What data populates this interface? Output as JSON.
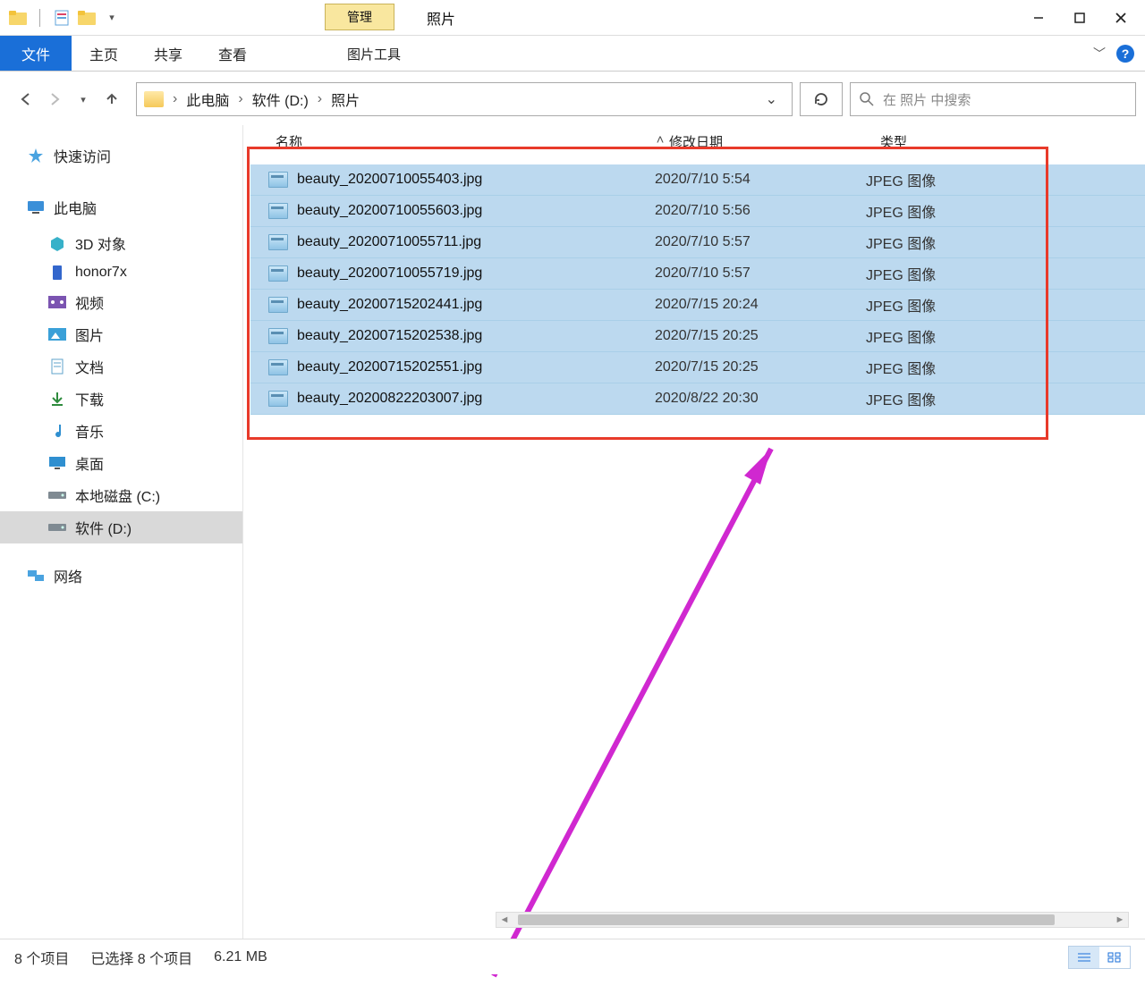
{
  "window": {
    "title": "照片"
  },
  "qat": {
    "manage_label": "管理"
  },
  "ribbon": {
    "file_label": "文件",
    "tabs": [
      "主页",
      "共享",
      "查看"
    ],
    "image_tools_label": "图片工具"
  },
  "nav": {
    "breadcrumb": [
      "此电脑",
      "软件 (D:)",
      "照片"
    ]
  },
  "search": {
    "placeholder": "在 照片 中搜索"
  },
  "sidebar": {
    "quick": "快速访问",
    "pc": "此电脑",
    "items": [
      {
        "label": "3D 对象",
        "icon": "cube"
      },
      {
        "label": "honor7x",
        "icon": "phone"
      },
      {
        "label": "视频",
        "icon": "video"
      },
      {
        "label": "图片",
        "icon": "picture"
      },
      {
        "label": "文档",
        "icon": "doc"
      },
      {
        "label": "下载",
        "icon": "download"
      },
      {
        "label": "音乐",
        "icon": "music"
      },
      {
        "label": "桌面",
        "icon": "desktop"
      },
      {
        "label": "本地磁盘 (C:)",
        "icon": "disk"
      },
      {
        "label": "软件 (D:)",
        "icon": "disk",
        "selected": true
      }
    ],
    "network": "网络"
  },
  "columns": {
    "name": "名称",
    "date": "修改日期",
    "type": "类型"
  },
  "files": [
    {
      "name": "beauty_20200710055403.jpg",
      "date": "2020/7/10 5:54",
      "type": "JPEG 图像"
    },
    {
      "name": "beauty_20200710055603.jpg",
      "date": "2020/7/10 5:56",
      "type": "JPEG 图像"
    },
    {
      "name": "beauty_20200710055711.jpg",
      "date": "2020/7/10 5:57",
      "type": "JPEG 图像"
    },
    {
      "name": "beauty_20200710055719.jpg",
      "date": "2020/7/10 5:57",
      "type": "JPEG 图像"
    },
    {
      "name": "beauty_20200715202441.jpg",
      "date": "2020/7/15 20:24",
      "type": "JPEG 图像"
    },
    {
      "name": "beauty_20200715202538.jpg",
      "date": "2020/7/15 20:25",
      "type": "JPEG 图像"
    },
    {
      "name": "beauty_20200715202551.jpg",
      "date": "2020/7/15 20:25",
      "type": "JPEG 图像"
    },
    {
      "name": "beauty_20200822203007.jpg",
      "date": "2020/8/22 20:30",
      "type": "JPEG 图像"
    }
  ],
  "status": {
    "count": "8 个项目",
    "selected": "已选择 8 个项目",
    "size": "6.21 MB"
  }
}
